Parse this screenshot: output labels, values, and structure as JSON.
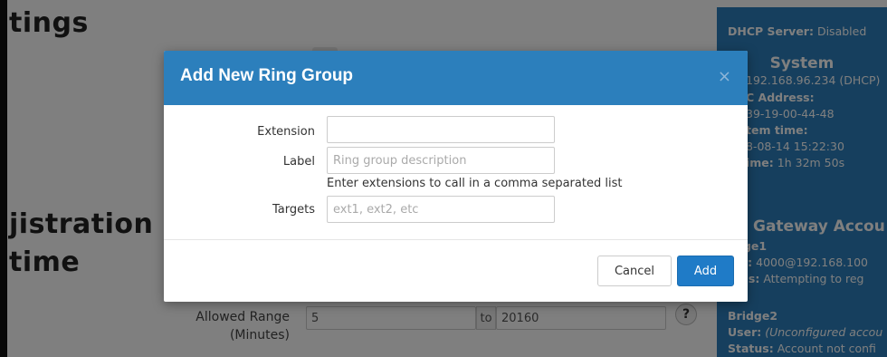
{
  "background": {
    "section_titles": [
      "tings",
      "jistration",
      "time"
    ],
    "allowed_range": {
      "label": "Allowed Range\n(Minutes)",
      "min_value": "5",
      "to_label": "to",
      "max_value": "20160",
      "help_glyph": "?"
    },
    "sidebar": {
      "dhcp_label": "DHCP Server:",
      "dhcp_value": "Disabled",
      "system_title": "System",
      "ip_value": "192.168.96.234 (DHCP)",
      "mac_label": "C Address:",
      "mac_value": "39-19-00-44-48",
      "time_label": "tem time:",
      "time_value": "8-08-14 15:22:30",
      "uptime_label": "ime:",
      "uptime_value": "1h 32m 50s",
      "gateway_title": "Gateway Accou",
      "bridge1_name": "dge1",
      "bridge1_user_label": "r:",
      "bridge1_user_value": "4000@192.168.100",
      "bridge1_status_label": "tus:",
      "bridge1_status_value": "Attempting to reg",
      "bridge2_name": "Bridge2",
      "bridge2_user_label": "User:",
      "bridge2_user_value": "(Unconfigured accou",
      "bridge2_status_label": "Status:",
      "bridge2_status_value": "Account not confi"
    }
  },
  "modal": {
    "title": "Add New Ring Group",
    "close_glyph": "×",
    "fields": {
      "extension": {
        "label": "Extension",
        "value": "",
        "placeholder": ""
      },
      "label": {
        "label": "Label",
        "value": "",
        "placeholder": "Ring group description"
      },
      "targets_help": "Enter extensions to call in a comma separated list",
      "targets": {
        "label": "Targets",
        "value": "",
        "placeholder": "ext1, ext2, etc"
      }
    },
    "buttons": {
      "cancel": "Cancel",
      "add": "Add"
    }
  },
  "colors": {
    "header": "#2c7fbc",
    "primary_button": "#1f7bc7",
    "overlay": "rgba(0,0,0,0.5)"
  }
}
